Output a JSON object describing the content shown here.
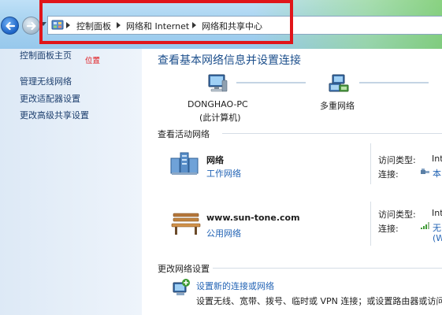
{
  "breadcrumb": {
    "items": [
      "控制面板",
      "网络和 Internet",
      "网络和共享中心"
    ]
  },
  "sidebar": {
    "home_link": "控制面板主页",
    "annotation": "位置",
    "links": [
      "管理无线网络",
      "更改适配器设置",
      "更改高级共享设置"
    ]
  },
  "main": {
    "title": "查看基本网络信息并设置连接",
    "map": {
      "computer_name": "DONGHAO-PC",
      "computer_sub": "(此计算机)",
      "network_label": "多重网络"
    },
    "active_section": "查看活动网络",
    "networks": [
      {
        "name": "网络",
        "type": "工作网络",
        "access_label": "访问类型:",
        "access_value": "Int",
        "conn_label": "连接:",
        "conn_value": "本"
      },
      {
        "name": "www.sun-tone.com",
        "type": "公用网络",
        "access_label": "访问类型:",
        "access_value": "Int",
        "conn_label": "连接:",
        "conn_value": "无",
        "conn_value2": "(W"
      }
    ],
    "change_section": "更改网络设置",
    "setup": {
      "link": "设置新的连接或网络",
      "desc": "设置无线、宽带、拨号、临时或 VPN 连接；或设置路由器或访问点"
    }
  },
  "colors": {
    "annotation_red": "#e0151a",
    "link_blue": "#2364b5",
    "title_blue": "#1c4f8c"
  }
}
